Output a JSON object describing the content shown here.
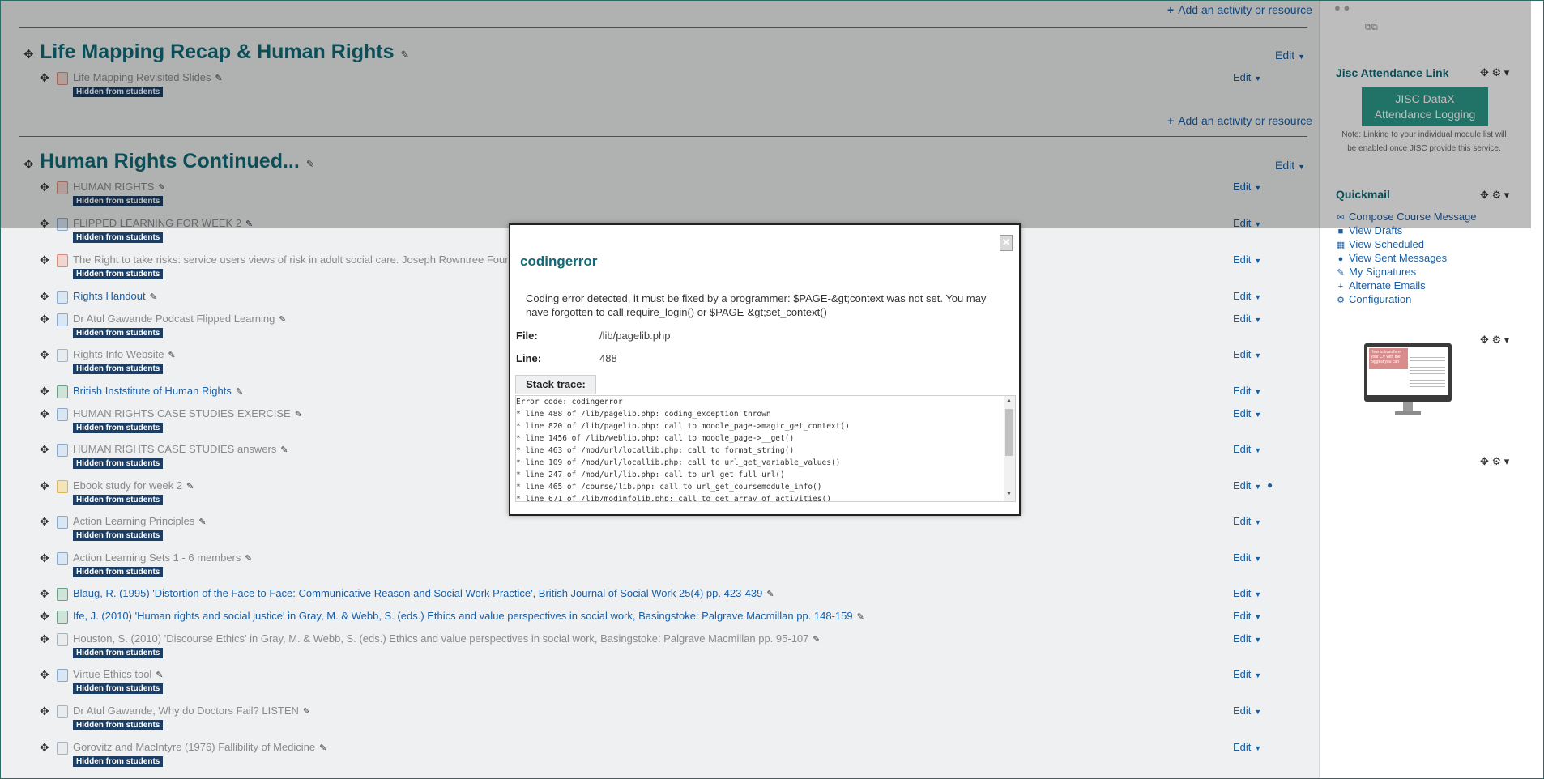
{
  "course": {
    "add_activity_label": "Add an activity or resource",
    "sections": [
      {
        "title": "Life Mapping Recap & Human Rights",
        "edit_label": "Edit",
        "activities": [
          {
            "name": "Life Mapping Revisited Slides",
            "icon": "pdf-icon",
            "hidden": true,
            "edit_label": "Edit"
          }
        ]
      },
      {
        "title": "Human Rights Continued...",
        "edit_label": "Edit",
        "activities": [
          {
            "name": "HUMAN RIGHTS",
            "icon": "pdf-icon",
            "hidden": true,
            "edit_label": "Edit"
          },
          {
            "name": "FLIPPED LEARNING FOR WEEK 2",
            "icon": "url-icon",
            "hidden": true,
            "edit_label": "Edit"
          },
          {
            "name": "The Right to take risks: service users views of risk in adult social care. Joseph Rowntree Foun",
            "icon": "pdf-icon",
            "hidden": true,
            "edit_label": "Edit"
          },
          {
            "name": "Rights Handout",
            "icon": "url-icon",
            "hidden": false,
            "edit_label": "Edit"
          },
          {
            "name": "Dr Atul Gawande Podcast Flipped Learning",
            "icon": "url-icon",
            "hidden": true,
            "edit_label": "Edit"
          },
          {
            "name": "Rights Info Website",
            "icon": "file-icon",
            "hidden": true,
            "edit_label": "Edit"
          },
          {
            "name": "British Inststitute of Human Rights",
            "icon": "globe-icon",
            "hidden": false,
            "edit_label": "Edit"
          },
          {
            "name": "HUMAN RIGHTS CASE STUDIES EXERCISE",
            "icon": "url-icon",
            "hidden": true,
            "edit_label": "Edit"
          },
          {
            "name": "HUMAN RIGHTS CASE STUDIES answers",
            "icon": "url-icon",
            "hidden": true,
            "edit_label": "Edit"
          },
          {
            "name": "Ebook study for week 2",
            "icon": "book-icon",
            "hidden": true,
            "edit_label": "Edit"
          },
          {
            "name": "Action Learning Principles",
            "icon": "url-icon",
            "hidden": true,
            "edit_label": "Edit"
          },
          {
            "name": "Action Learning Sets 1 - 6 members",
            "icon": "url-icon",
            "hidden": true,
            "edit_label": "Edit"
          },
          {
            "name": "Blaug, R. (1995) 'Distortion of the Face to Face: Communicative Reason and Social Work Practice', British Journal of Social Work 25(4) pp. 423-439",
            "icon": "globe-icon",
            "hidden": false,
            "edit_label": "Edit"
          },
          {
            "name": "Ife, J. (2010) 'Human rights and social justice' in Gray, M. & Webb, S. (eds.) Ethics and value perspectives in social work, Basingstoke: Palgrave Macmillan pp. 148-159",
            "icon": "globe-icon",
            "hidden": false,
            "edit_label": "Edit"
          },
          {
            "name": "Houston, S. (2010) 'Discourse Ethics' in Gray, M. & Webb, S. (eds.) Ethics and value perspectives in social work, Basingstoke: Palgrave Macmillan pp. 95-107",
            "icon": "file-icon",
            "hidden": true,
            "edit_label": "Edit"
          },
          {
            "name": "Virtue Ethics tool",
            "icon": "url-icon",
            "hidden": true,
            "edit_label": "Edit"
          },
          {
            "name": "Dr Atul Gawande, Why do Doctors Fail? LISTEN",
            "icon": "file-icon",
            "hidden": true,
            "edit_label": "Edit"
          },
          {
            "name": "Gorovitz and MacIntyre (1976) Fallibility of Medicine",
            "icon": "file-icon",
            "hidden": true,
            "edit_label": "Edit"
          }
        ]
      }
    ],
    "hidden_badge_label": "Hidden from students"
  },
  "sidebar": {
    "jisc": {
      "title": "Jisc Attendance Link",
      "button_line1": "JISC DataX",
      "button_line2": "Attendance Logging",
      "note": "Note: Linking to your individual module list will be enabled once JISC provide this service."
    },
    "quickmail": {
      "title": "Quickmail",
      "items": [
        {
          "label": "Compose Course Message",
          "icon": "envelope-icon"
        },
        {
          "label": "View Drafts",
          "icon": "drafts-icon"
        },
        {
          "label": "View Scheduled",
          "icon": "calendar-icon"
        },
        {
          "label": "View Sent Messages",
          "icon": "speech-icon"
        },
        {
          "label": "My Signatures",
          "icon": "pen-icon"
        },
        {
          "label": "Alternate Emails",
          "icon": "plus-icon"
        },
        {
          "label": "Configuration",
          "icon": "gear-icon"
        }
      ]
    },
    "promo_text": "How to transform your CV with the biggest you can"
  },
  "modal": {
    "title": "codingerror",
    "close_symbol": "×",
    "message": "Coding error detected, it must be fixed by a programmer: $PAGE-&gt;context was not set. You may have forgotten to call require_login() or $PAGE-&gt;set_context()",
    "file_label": "File:",
    "file_value": "/lib/pagelib.php",
    "line_label": "Line:",
    "line_value": "488",
    "stack_tab_label": "Stack trace:",
    "stack_lines": [
      "Error code: codingerror",
      "* line 488 of /lib/pagelib.php: coding_exception thrown",
      "* line 820 of /lib/pagelib.php: call to moodle_page->magic_get_context()",
      "* line 1456 of /lib/weblib.php: call to moodle_page->__get()",
      "* line 463 of /mod/url/locallib.php: call to format_string()",
      "* line 109 of /mod/url/locallib.php: call to url_get_variable_values()",
      "* line 247 of /mod/url/lib.php: call to url_get_full_url()",
      "* line 465 of /course/lib.php: call to url_get_coursemodule_info()",
      "* line 671 of /lib/modinfolib.php: call to get_array_of_activities()"
    ]
  }
}
